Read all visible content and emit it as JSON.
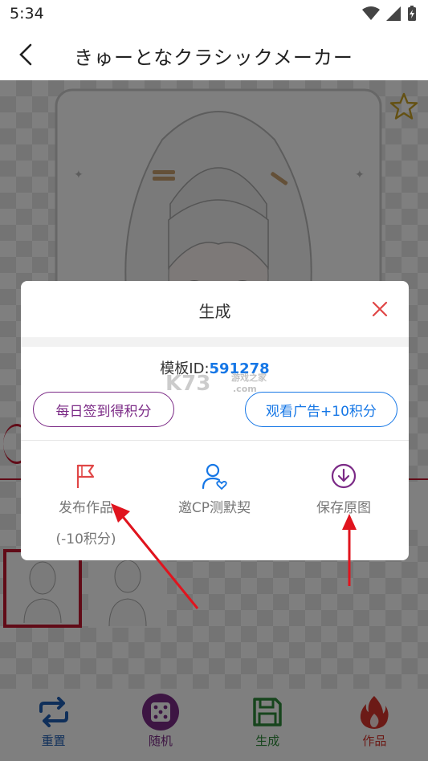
{
  "status_bar": {
    "time": "5:34"
  },
  "header": {
    "title": "きゅーとなクラシックメーカー"
  },
  "dialog": {
    "title": "生成",
    "template_id_label": "模板ID:",
    "template_id_value": "591278",
    "watermark": "K73 游戏之家 .com",
    "checkin_button": "每日签到得积分",
    "ad_button": "观看广告+10积分",
    "actions": [
      {
        "label": "发布作品",
        "sub": "(-10积分)",
        "icon": "flag-icon"
      },
      {
        "label": "邀CP测默契",
        "icon": "user-heart-icon"
      },
      {
        "label": "保存原图",
        "icon": "download-circle-icon"
      }
    ]
  },
  "bottom_nav": [
    {
      "label": "重置",
      "icon": "repeat-icon",
      "color": "#1f5fb5"
    },
    {
      "label": "随机",
      "icon": "dice-icon",
      "color": "#7b2a86"
    },
    {
      "label": "生成",
      "icon": "save-icon",
      "color": "#2e8b3a"
    },
    {
      "label": "作品",
      "icon": "fire-icon",
      "color": "#d8352c"
    }
  ],
  "colors": {
    "accent_red": "#c2162f",
    "blue": "#1677e6",
    "purple": "#7b2a86",
    "arrow": "#e0141e"
  }
}
